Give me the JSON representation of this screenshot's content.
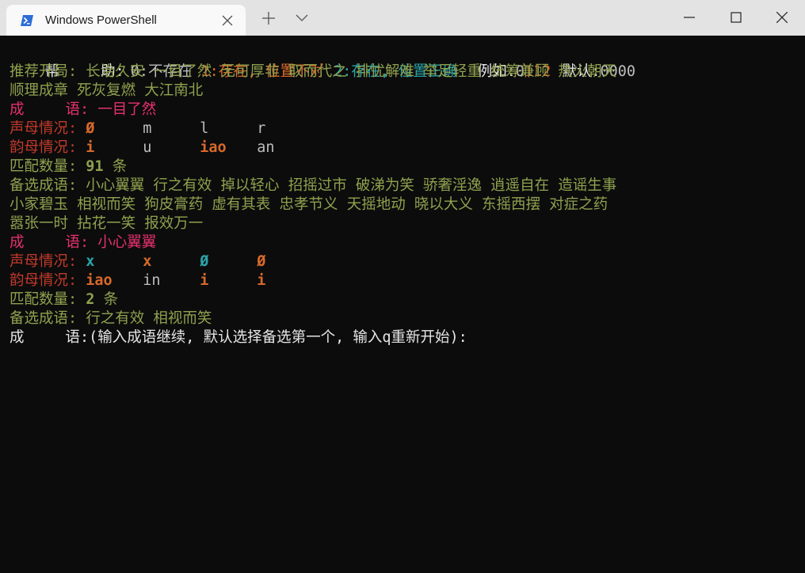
{
  "window": {
    "tab_title": "Windows PowerShell",
    "colors": {
      "titlebar": "#e3e3e3",
      "tab": "#f9f9f9",
      "terminal_bg": "#0c0c0c",
      "icon_blue": "#2d6dd4"
    }
  },
  "terminal": {
    "help": {
      "label_a": "帮",
      "label_b": "助:",
      "opt0": "0:不存在",
      "opt1": "1:存在, 位置不对",
      "opt2": "2:存在, 位置正确",
      "example_label": "例如:",
      "example_a": "0",
      "example_b": "112",
      "default_label": "默认:",
      "default_value": "0000"
    },
    "recommend": {
      "label": "推荐开局:",
      "line1": "长治久安 一目了然 无可厚非 取而代之 排忧解难 举足轻重 统筹兼顾 热火朝天",
      "line2": "顺理成章 死灰复燃 大江南北"
    },
    "round1": {
      "idiom_label_a": "成",
      "idiom_label_b": "语:",
      "idiom": "一目了然",
      "initials_label": "声母情况:",
      "initials": [
        "Ø",
        "m",
        "l",
        "r"
      ],
      "finals_label": "韵母情况:",
      "finals": [
        "i",
        "u",
        "iao",
        "an"
      ],
      "match_label": "匹配数量:",
      "match_count": "91",
      "match_unit": "条",
      "candidates_label": "备选成语:",
      "candidates_line1": "小心翼翼 行之有效 掉以轻心 招摇过市 破涕为笑 骄奢淫逸 逍遥自在 造谣生事",
      "candidates_line2": "小家碧玉 相视而笑 狗皮膏药 虚有其表 忠孝节义 天摇地动 晓以大义 东摇西摆 对症之药",
      "candidates_line3": "嚣张一时 拈花一笑 报效万一"
    },
    "round2": {
      "idiom_label_a": "成",
      "idiom_label_b": "语:",
      "idiom": "小心翼翼",
      "initials_label": "声母情况:",
      "initials": [
        "x",
        "x",
        "Ø",
        "Ø"
      ],
      "finals_label": "韵母情况:",
      "finals": [
        "iao",
        "in",
        "i",
        "i"
      ],
      "match_label": "匹配数量:",
      "match_count": "2",
      "match_unit": "条",
      "candidates_label": "备选成语:",
      "candidates_line1": "行之有效 相视而笑"
    },
    "prompt": {
      "label_a": "成",
      "label_b": "语:",
      "text": "(输入成语继续, 默认选择备选第一个, 输入q重新开始):"
    }
  }
}
